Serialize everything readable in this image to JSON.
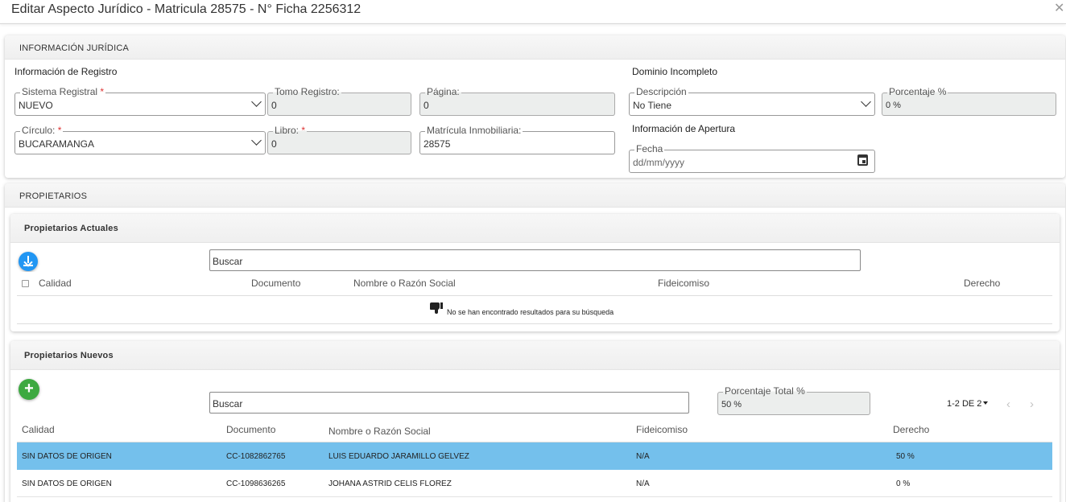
{
  "dialog": {
    "title": "Editar Aspecto Jurídico - Matricula 28575 - N° Ficha 2256312",
    "close_glyph": "✕"
  },
  "informacion_juridica": {
    "header": "INFORMACIÓN JURÍDICA",
    "registro": {
      "heading": "Información de Registro",
      "sistema_registral": {
        "label": "Sistema Registral",
        "required": "*",
        "value": "NUEVO"
      },
      "tomo_registro": {
        "label": "Tomo Registro:",
        "value": "0"
      },
      "pagina": {
        "label": "Página:",
        "value": "0"
      },
      "circulo": {
        "label": "Círculo:",
        "required": "*",
        "value": "BUCARAMANGA"
      },
      "libro": {
        "label": "Libro:",
        "required": "*",
        "value": "0"
      },
      "matricula_inmobiliaria": {
        "label": "Matrícula Inmobiliaria:",
        "value": "28575"
      }
    },
    "dominio": {
      "heading": "Dominio Incompleto",
      "descripcion": {
        "label": "Descripción",
        "value": "No Tiene"
      },
      "porcentaje": {
        "label": "Porcentaje %",
        "value": "0 %"
      }
    },
    "apertura": {
      "heading": "Información de Apertura",
      "fecha": {
        "label": "Fecha",
        "placeholder": "dd/mm/yyyy"
      }
    }
  },
  "propietarios": {
    "header": "PROPIETARIOS",
    "actuales": {
      "header": "Propietarios Actuales",
      "search_placeholder": "Buscar",
      "columns": [
        "Calidad",
        "Documento",
        "Nombre o Razón Social",
        "Fideicomiso",
        "Derecho"
      ],
      "empty_message": "No se han encontrado resultados para su búsqueda"
    },
    "nuevos": {
      "header": "Propietarios Nuevos",
      "search_placeholder": "Buscar",
      "porcentaje_total": {
        "label": "Porcentaje Total %",
        "value": "50 %"
      },
      "pager": {
        "text": "1-2 DE 2",
        "prev": "‹",
        "next": "›"
      },
      "columns": [
        "Calidad",
        "Documento",
        "Nombre o Razón Social",
        "Fideicomiso",
        "Derecho"
      ],
      "rows": [
        {
          "calidad": "SIN DATOS DE ORIGEN",
          "documento": "CC-1082862765",
          "nombre": "LUIS EDUARDO JARAMILLO GELVEZ",
          "fideicomiso": "N/A",
          "derecho": "50 %",
          "selected": true
        },
        {
          "calidad": "SIN DATOS DE ORIGEN",
          "documento": "CC-1098636265",
          "nombre": "JOHANA ASTRID CELIS FLOREZ",
          "fideicomiso": "N/A",
          "derecho": "0 %",
          "selected": false
        }
      ]
    }
  },
  "colors": {
    "selected_row": "#74c0ec",
    "download_button": "#2196f3",
    "add_button": "#3da941",
    "required": "#dd3333"
  },
  "icons": {
    "download": "download-icon",
    "add": "plus-icon",
    "empty": "thumbs-down-icon",
    "calendar": "calendar-icon"
  }
}
